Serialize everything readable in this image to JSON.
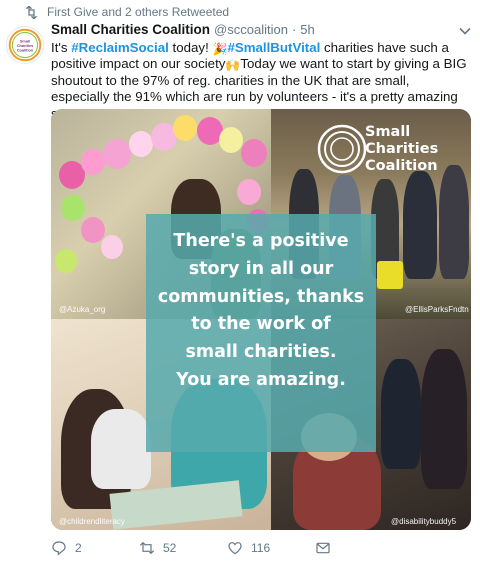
{
  "retweet_context": {
    "text": "First Give and 2 others Retweeted"
  },
  "author": {
    "display_name": "Small Charities Coalition",
    "handle": "@sccoalition",
    "separator": "·",
    "time": "5h",
    "avatar_label": "Small Charities Coalition"
  },
  "tweet": {
    "p1": "It's ",
    "tag1": "#ReclaimSocial",
    "p2": " today! ",
    "tag2": "#SmallButVital",
    "p3": " charities have such a positive impact on our society",
    "p4": "Today we want to start by giving a BIG shoutout to the 97% of reg. charities in the UK that are small, especially the 91% which are run by volunteers - it's a pretty amazing story ",
    "emoji_party": "🎉",
    "emoji_hands": "🙌",
    "emoji_hearteyes": "😍"
  },
  "media": {
    "logo_line1": "Small",
    "logo_line2": "Charities",
    "logo_line3": "Coalition",
    "overlay_lines": [
      "There's a positive",
      "story in all our",
      "communities, thanks",
      "to the work of",
      "small charities.",
      "You are amazing."
    ],
    "tags": {
      "tl": "@Azuka_org",
      "tr": "@EllisParksFndtn",
      "bl": "@childrendliteracy",
      "br": "@disabilitybuddy5"
    }
  },
  "actions": {
    "reply_count": "2",
    "retweet_count": "52",
    "like_count": "116"
  },
  "colors": {
    "link": "#1b95e0",
    "muted": "#657786",
    "overlay": "#57aaae"
  },
  "icons": [
    "retweet-icon",
    "chevron-down-icon",
    "reply-icon",
    "retweet-icon",
    "heart-icon",
    "mail-icon"
  ]
}
